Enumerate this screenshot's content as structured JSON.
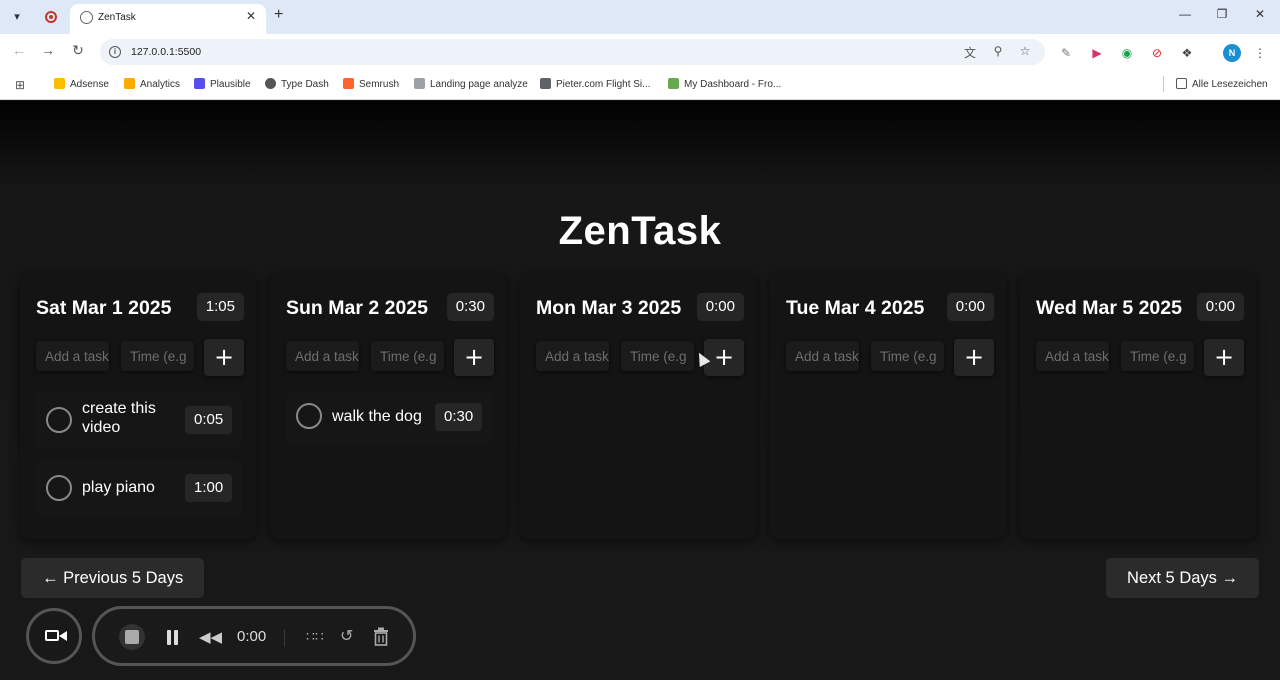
{
  "browser": {
    "tab_title": "ZenTask",
    "url": "127.0.0.1:5500",
    "profile_initial": "N",
    "bookmarks": [
      {
        "label": "Adsense",
        "color": "#fbbc04"
      },
      {
        "label": "Analytics",
        "color": "#f9ab00"
      },
      {
        "label": "Plausible",
        "color": "#5850ec"
      },
      {
        "label": "Type Dash",
        "color": "#555555"
      },
      {
        "label": "Semrush",
        "color": "#ff642d"
      },
      {
        "label": "Landing page analyze",
        "color": "#9aa0a6"
      },
      {
        "label": "Pieter.com Flight Si...",
        "color": "#5f6368"
      },
      {
        "label": "My Dashboard - Fro...",
        "color": "#6aa84f"
      }
    ],
    "bookmarks_folder": "Alle Lesezeichen"
  },
  "app": {
    "title": "ZenTask",
    "task_placeholder": "Add a task",
    "time_placeholder": "Time (e.g",
    "add_label": "+",
    "days": [
      {
        "date": "Sat Mar 1 2025",
        "total": "1:05",
        "tasks": [
          {
            "text": "create this video",
            "duration": "0:05"
          },
          {
            "text": "play piano",
            "duration": "1:00"
          }
        ]
      },
      {
        "date": "Sun Mar 2 2025",
        "total": "0:30",
        "tasks": [
          {
            "text": "walk the dog",
            "duration": "0:30"
          }
        ]
      },
      {
        "date": "Mon Mar 3 2025",
        "total": "0:00",
        "tasks": []
      },
      {
        "date": "Tue Mar 4 2025",
        "total": "0:00",
        "tasks": []
      },
      {
        "date": "Wed Mar 5 2025",
        "total": "0:00",
        "tasks": []
      }
    ],
    "prev_label": "← Previous 5 Days",
    "next_label": "Next 5 Days →"
  },
  "recorder": {
    "time": "0:00"
  }
}
